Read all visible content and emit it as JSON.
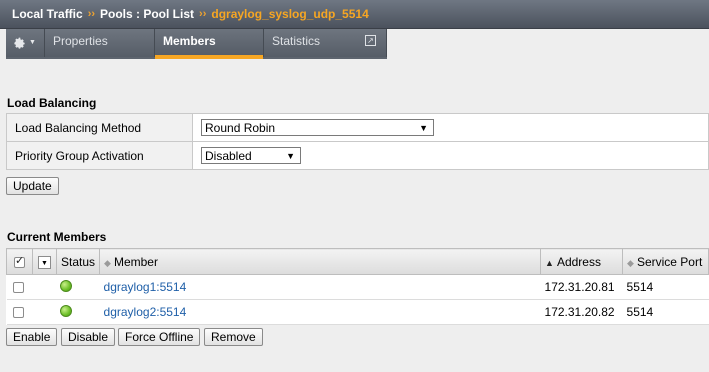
{
  "breadcrumb": {
    "part1": "Local Traffic",
    "part2": "Pools : Pool List",
    "current": "dgraylog_syslog_udp_5514",
    "separator": "››"
  },
  "tabs": {
    "properties": "Properties",
    "members": "Members",
    "statistics": "Statistics"
  },
  "load_balancing": {
    "title": "Load Balancing",
    "method_label": "Load Balancing Method",
    "method_value": "Round Robin",
    "priority_label": "Priority Group Activation",
    "priority_value": "Disabled",
    "update_button": "Update"
  },
  "current_members": {
    "title": "Current Members",
    "headers": {
      "status": "Status",
      "member": "Member",
      "address": "Address",
      "service_port": "Service Port"
    },
    "rows": [
      {
        "member": "dgraylog1:5514",
        "address": "172.31.20.81",
        "port": "5514",
        "status": "green"
      },
      {
        "member": "dgraylog2:5514",
        "address": "172.31.20.82",
        "port": "5514",
        "status": "green"
      }
    ],
    "buttons": {
      "enable": "Enable",
      "disable": "Disable",
      "force_offline": "Force Offline",
      "remove": "Remove"
    }
  },
  "colors": {
    "accent": "#f6a623",
    "link": "#1f5fa8",
    "status_available": "#6cbf27"
  },
  "icons": {
    "gear": "gear-icon",
    "external": "external-link-icon"
  }
}
